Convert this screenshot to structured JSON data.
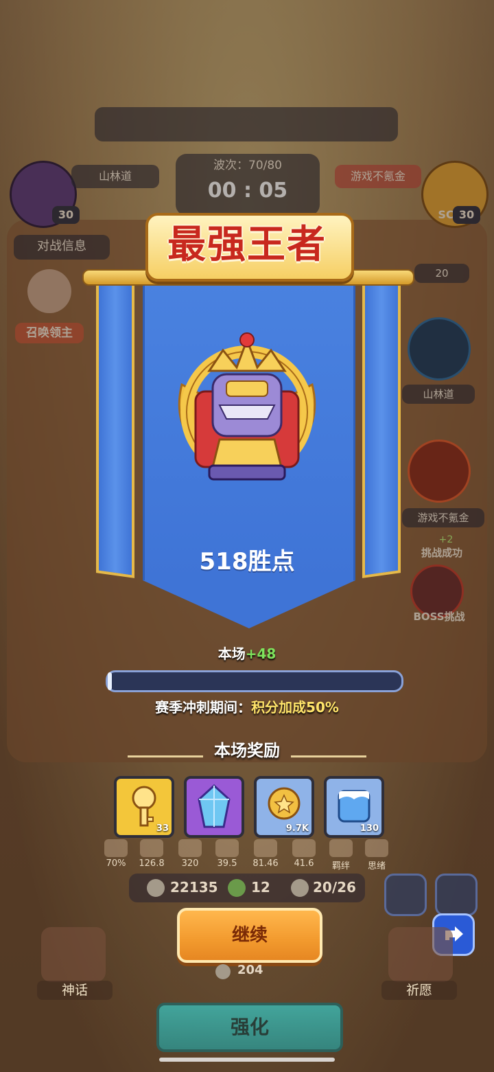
{
  "hud": {
    "wave_label": "波次：70/80",
    "timer": "00 : 05",
    "player_left_name": "山林道",
    "player_right_name": "游戏不氪金",
    "left_level": "30",
    "right_level": "30",
    "right_score_partial": "SC",
    "battle_info_label": "对战信息",
    "summon_lord_label": "召唤领主",
    "hearts": "20",
    "right_panel_name_1": "山林道",
    "right_panel_name_2": "游戏不氪金",
    "challenge_bonus": "+2",
    "challenge_success": "挑战成功",
    "boss_challenge": "BOSS挑战"
  },
  "result": {
    "title": "最强王者",
    "points_text": "518胜点",
    "gain_prefix": "本场",
    "gain_value": "+48",
    "progress_fraction": 0.01,
    "season_prefix": "赛季冲刺期间：",
    "season_bonus": "积分加成50%"
  },
  "rewards": {
    "title": "本场奖励",
    "items": [
      {
        "icon": "golden-key-icon",
        "count": "33",
        "color": "#f3c63a"
      },
      {
        "icon": "purple-crystal-icon",
        "count": "",
        "color": "#9a5ad6"
      },
      {
        "icon": "gold-coin-icon",
        "count": "9.7K",
        "color": "#8fb3e8"
      },
      {
        "icon": "ice-cube-icon",
        "count": "130",
        "color": "#8fb3e8"
      }
    ]
  },
  "stats": [
    {
      "icon": "heart-icon",
      "value": "70%"
    },
    {
      "icon": "sword-icon",
      "value": "126.8"
    },
    {
      "icon": "burst-icon",
      "value": "320"
    },
    {
      "icon": "crit-icon",
      "value": "39.5"
    },
    {
      "icon": "speed-icon",
      "value": "81.46"
    },
    {
      "icon": "gear-icon",
      "value": "41.6"
    },
    {
      "icon": "bond-icon",
      "value": "羁绊"
    },
    {
      "icon": "thought-icon",
      "value": "思绪"
    }
  ],
  "currency": {
    "value_1": "22135",
    "value_2": "12",
    "value_3": "20/26",
    "below_button": "204"
  },
  "buttons": {
    "continue": "继续",
    "enhance": "强化",
    "left_side": "神话",
    "right_side": "祈愿"
  },
  "colors": {
    "banner": "#3f74d6",
    "title_red": "#c8281e",
    "gain_green": "#7ee35c",
    "bonus_yellow": "#ffe46a",
    "continue_orange": "#f29a2e"
  }
}
